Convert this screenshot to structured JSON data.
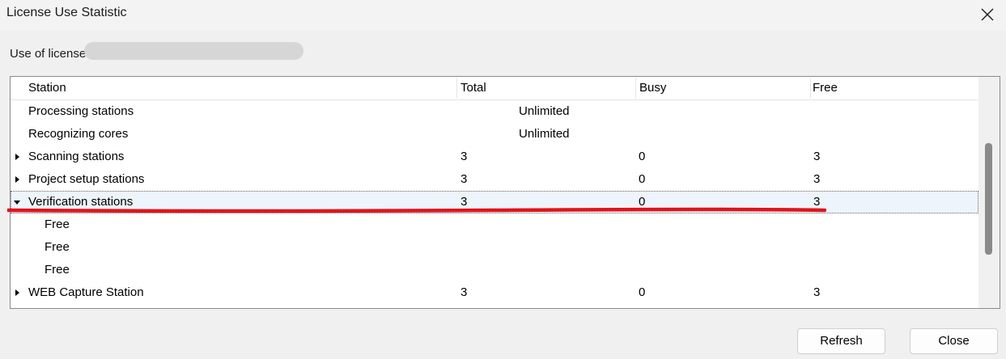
{
  "window": {
    "title": "License Use Statistic"
  },
  "license": {
    "label": "Use of license"
  },
  "table": {
    "columns": [
      "Station",
      "Total",
      "Busy",
      "Free"
    ],
    "rows": [
      {
        "station": "Processing stations",
        "total": "Unlimited",
        "busy": "",
        "free": "",
        "level": 0,
        "expander": "none"
      },
      {
        "station": "Recognizing cores",
        "total": "Unlimited",
        "busy": "",
        "free": "",
        "level": 0,
        "expander": "none"
      },
      {
        "station": "Scanning stations",
        "total": "3",
        "busy": "0",
        "free": "3",
        "level": 0,
        "expander": "collapsed"
      },
      {
        "station": "Project setup stations",
        "total": "3",
        "busy": "0",
        "free": "3",
        "level": 0,
        "expander": "collapsed"
      },
      {
        "station": "Verification stations",
        "total": "3",
        "busy": "0",
        "free": "3",
        "level": 0,
        "expander": "expanded",
        "selected": true
      },
      {
        "station": "Free",
        "total": "",
        "busy": "",
        "free": "",
        "level": 1,
        "expander": "none"
      },
      {
        "station": "Free",
        "total": "",
        "busy": "",
        "free": "",
        "level": 1,
        "expander": "none"
      },
      {
        "station": "Free",
        "total": "",
        "busy": "",
        "free": "",
        "level": 1,
        "expander": "none"
      },
      {
        "station": "WEB Capture Station",
        "total": "3",
        "busy": "0",
        "free": "3",
        "level": 0,
        "expander": "collapsed"
      }
    ]
  },
  "buttons": {
    "refresh": "Refresh",
    "close": "Close"
  },
  "icons": {
    "close": "close-icon",
    "expand": "triangle-right-icon",
    "collapse": "triangle-down-icon"
  },
  "colors": {
    "annotation": "#e0141c",
    "selection": "#eef4fb"
  }
}
